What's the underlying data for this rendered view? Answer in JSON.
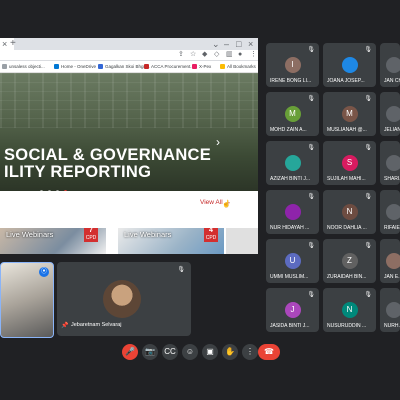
{
  "browser": {
    "close_tab": "×",
    "new_tab": "+",
    "window_controls": [
      "⌄",
      "–",
      "□",
      "×"
    ],
    "bookmarks": [
      {
        "label": "unsaless objecti...",
        "color": "#9aa0a6"
      },
      {
        "label": "Home - OneDrive",
        "color": "#0078d4"
      },
      {
        "label": "Gagalkan Skoi Bhgn...",
        "color": "#3367d6"
      },
      {
        "label": "ACCA Procurement...",
        "color": "#c62828"
      },
      {
        "label": "X-Pex",
        "color": "#e91e63"
      },
      {
        "label": "All Bookmarks",
        "color": "#fbbc04"
      }
    ]
  },
  "page": {
    "hero_line1": "SOCIAL & GOVERNANCE",
    "hero_line2": "ILITY REPORTING",
    "hero_arrow": "›",
    "view_all": "View All →",
    "cards": [
      {
        "label": "Live Webinars",
        "cpd": "7",
        "cpd_unit": "CPD"
      },
      {
        "label": "Live Webinars",
        "cpd": "4",
        "cpd_unit": "CPD"
      }
    ]
  },
  "presenter": {
    "name": "Jebaretnam Selvaraj"
  },
  "participants": [
    {
      "name": "IRENE BONG LI...",
      "initial": "I",
      "color": "#8d6e63"
    },
    {
      "name": "JOANA JOSEP...",
      "initial": "",
      "color": "#1e88e5",
      "photo": true
    },
    {
      "name": "JAN CH...",
      "initial": "",
      "color": "#5f6368"
    },
    {
      "name": "MOHD ZAIN A...",
      "initial": "M",
      "color": "#689f38"
    },
    {
      "name": "MUSLIANAH @...",
      "initial": "M",
      "color": "#795548"
    },
    {
      "name": "JELIANI...",
      "initial": "",
      "color": "#5f6368"
    },
    {
      "name": "AZIZAH BINTI J...",
      "initial": "",
      "color": "#26a69a",
      "photo": true
    },
    {
      "name": "SUJILAH MAHI...",
      "initial": "S",
      "color": "#d81b60"
    },
    {
      "name": "SHARI...",
      "initial": "",
      "color": "#5f6368"
    },
    {
      "name": "NUR HIDAYAH ...",
      "initial": "",
      "color": "#8e24aa",
      "photo": true
    },
    {
      "name": "NOOR DAHLIA ...",
      "initial": "N",
      "color": "#6d4c41"
    },
    {
      "name": "RIFAIE...",
      "initial": "",
      "color": "#5f6368"
    },
    {
      "name": "UMMI MUSLIM...",
      "initial": "U",
      "color": "#5c6bc0"
    },
    {
      "name": "ZURAIDAH BIN...",
      "initial": "Z",
      "color": "#616161"
    },
    {
      "name": "JAN E...",
      "initial": "",
      "color": "#8d6e63",
      "photo": true
    },
    {
      "name": "JASIDA BINTI J...",
      "initial": "J",
      "color": "#ab47bc"
    },
    {
      "name": "NUSURUDDIN ...",
      "initial": "N",
      "color": "#00897b"
    },
    {
      "name": "NURH...",
      "initial": "",
      "color": "#5f6368"
    }
  ],
  "controls": {
    "mic": "🎤",
    "camera": "📷",
    "captions": "CC",
    "emoji": "☺",
    "present": "▣",
    "raise_hand": "✋",
    "more": "⋮",
    "end_call": "☎"
  }
}
